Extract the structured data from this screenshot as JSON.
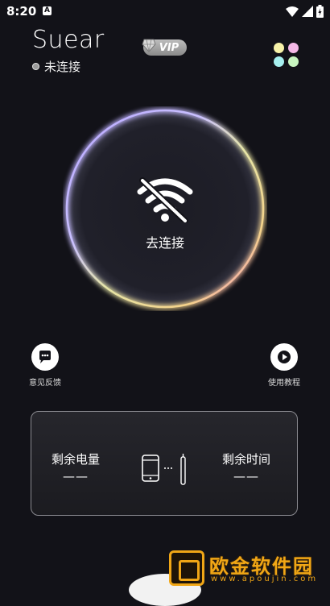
{
  "status_bar": {
    "time": "8:20",
    "notification_glyph": "A"
  },
  "header": {
    "app_title": "Suear",
    "connection_status": "未连接",
    "vip_label": "VIP"
  },
  "main": {
    "connect_label": "去连接"
  },
  "actions": {
    "feedback_label": "意见反馈",
    "tutorial_label": "使用教程"
  },
  "info_card": {
    "battery_title": "剩余电量",
    "battery_value": "——",
    "time_title": "剩余时间",
    "time_value": "——"
  },
  "watermark": {
    "text": "欧金软件园",
    "url": "www.apoujin.com"
  },
  "colors": {
    "background": "#121218",
    "dot_yellow": "#f7f2a8",
    "dot_pink": "#f4b8e6",
    "dot_cyan": "#a6f0ef",
    "dot_green": "#c8f5c0",
    "watermark": "#f0a616"
  },
  "icons": [
    "wifi-off-icon",
    "chat-icon",
    "play-icon",
    "phone-icon",
    "earpick-icon",
    "signal-icon",
    "wifi-icon",
    "battery-icon",
    "menu-dots-icon",
    "vip-gem-icon"
  ]
}
